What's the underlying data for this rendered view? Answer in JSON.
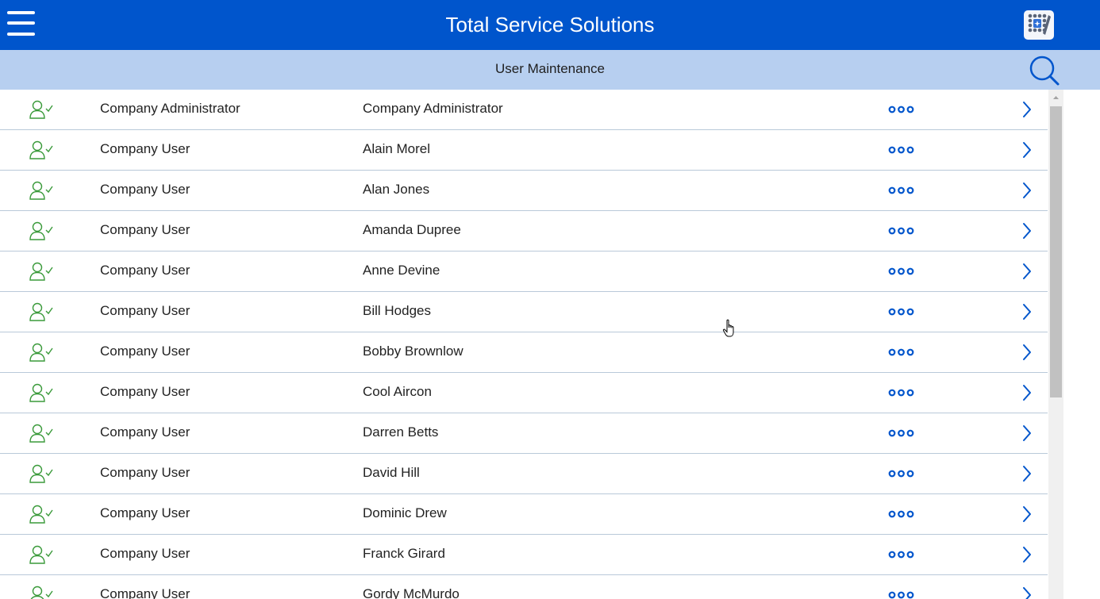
{
  "header": {
    "title": "Total Service Solutions",
    "menu_icon": "hamburger-menu-icon",
    "logo_icon": "app-grid-logo-icon",
    "bg_color": "#0055cc"
  },
  "subheader": {
    "title": "User Maintenance",
    "search_icon": "search-icon",
    "bg_color": "#b7cff0"
  },
  "colors": {
    "accent": "#0055cc",
    "user_icon": "#3a9a3a",
    "divider": "#b9c9d9"
  },
  "users": [
    {
      "role": "Company Administrator",
      "name": "Company Administrator"
    },
    {
      "role": "Company User",
      "name": "Alain Morel"
    },
    {
      "role": "Company User",
      "name": "Alan Jones"
    },
    {
      "role": "Company User",
      "name": "Amanda Dupree"
    },
    {
      "role": "Company User",
      "name": "Anne Devine"
    },
    {
      "role": "Company User",
      "name": "Bill Hodges"
    },
    {
      "role": "Company User",
      "name": "Bobby Brownlow"
    },
    {
      "role": "Company User",
      "name": "Cool Aircon"
    },
    {
      "role": "Company User",
      "name": "Darren Betts"
    },
    {
      "role": "Company User",
      "name": "David Hill"
    },
    {
      "role": "Company User",
      "name": "Dominic Drew"
    },
    {
      "role": "Company User",
      "name": "Franck Girard"
    },
    {
      "role": "Company User",
      "name": "Gordy McMurdo"
    }
  ],
  "row_icons": {
    "status": "user-check-icon",
    "more": "more-options-icon",
    "open": "chevron-right-icon"
  }
}
